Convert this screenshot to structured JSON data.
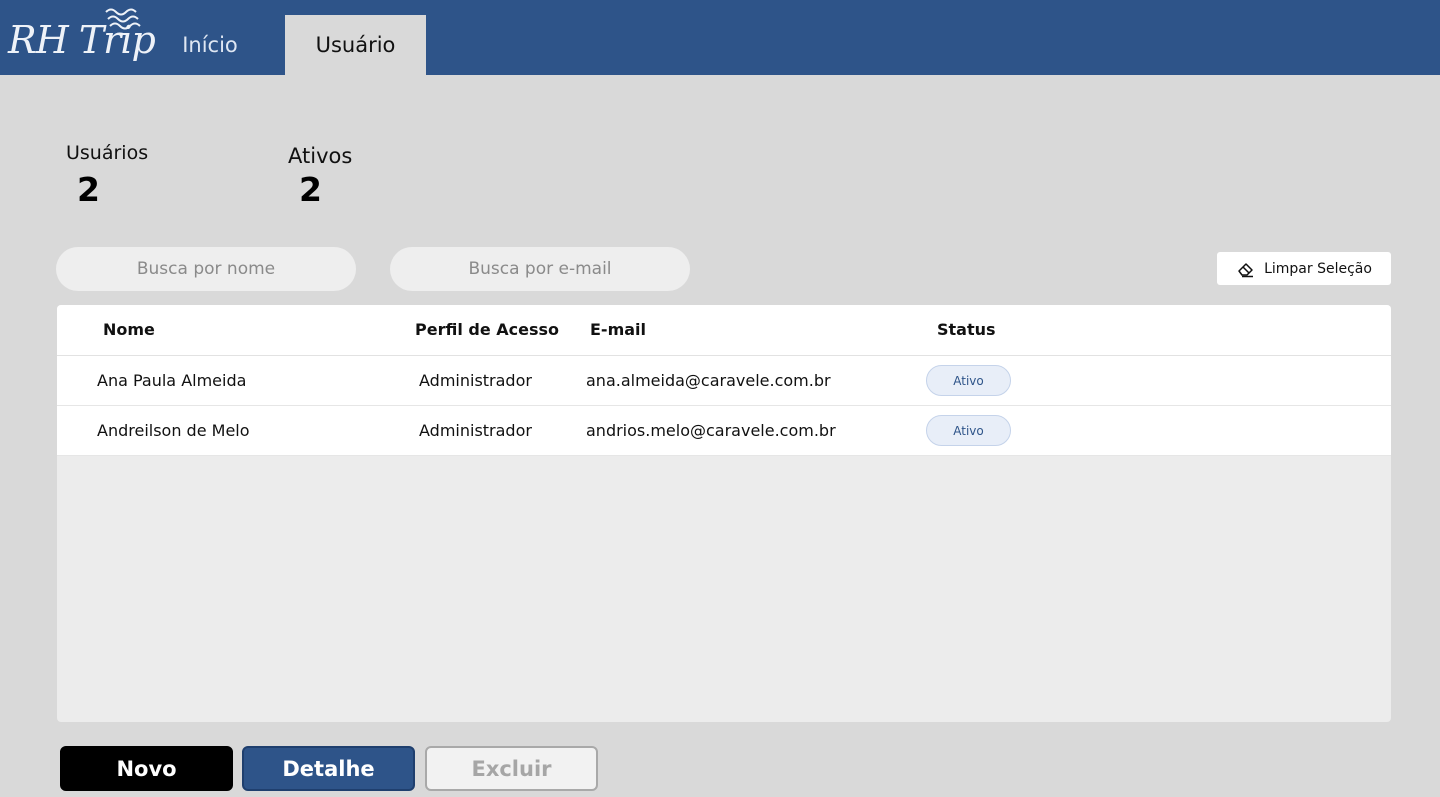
{
  "header": {
    "logo_text": "RH Trip",
    "tabs": [
      {
        "label": "Início",
        "active": false
      },
      {
        "label": "Usuário",
        "active": true
      }
    ]
  },
  "stats": {
    "users_label": "Usuários",
    "users_value": "2",
    "active_label": "Ativos",
    "active_value": "2"
  },
  "search": {
    "name_placeholder": "Busca por nome",
    "name_value": "",
    "email_placeholder": "Busca por e-mail",
    "email_value": ""
  },
  "clear_selection_label": "Limpar Seleção",
  "table": {
    "columns": [
      "Nome",
      "Perfil de Acesso",
      "E-mail",
      "Status"
    ],
    "rows": [
      {
        "name": "Ana Paula Almeida",
        "profile": "Administrador",
        "email": "ana.almeida@caravele.com.br",
        "status": "Ativo"
      },
      {
        "name": "Andreilson de Melo",
        "profile": "Administrador",
        "email": "andrios.melo@caravele.com.br",
        "status": "Ativo"
      }
    ]
  },
  "actions": {
    "new_label": "Novo",
    "detail_label": "Detalhe",
    "delete_label": "Excluir"
  },
  "colors": {
    "header_bg": "#2e5489",
    "page_bg": "#d9d9d9",
    "status_badge_bg": "#e8eef8"
  },
  "icons": {
    "clear": "eraser-icon",
    "logo_decoration": "wave-icon"
  }
}
